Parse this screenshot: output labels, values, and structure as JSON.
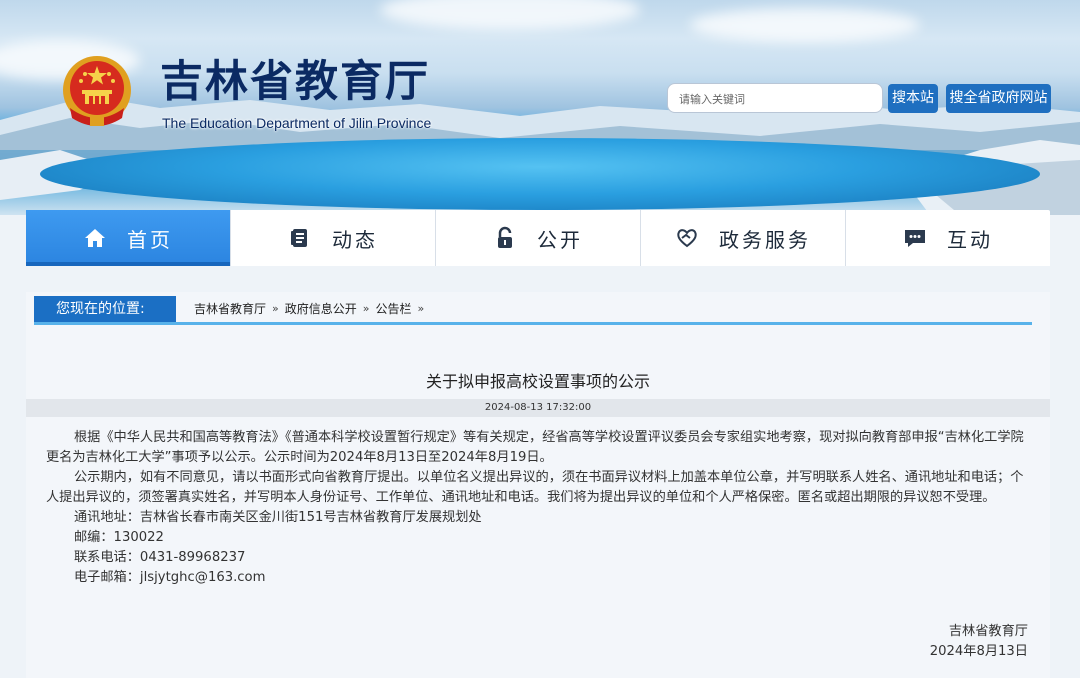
{
  "header": {
    "title": "吉林省教育厅",
    "subtitle": "The Education Department of Jilin Province",
    "search_placeholder": "请输入关键词",
    "search_site_label": "搜本站",
    "search_all_label": "搜全省政府网站"
  },
  "nav": {
    "items": [
      {
        "label": "首页",
        "icon": "home-icon",
        "active": true
      },
      {
        "label": "动态",
        "icon": "document-icon"
      },
      {
        "label": "公开",
        "icon": "lock-icon"
      },
      {
        "label": "政务服务",
        "icon": "heart-hands-icon"
      },
      {
        "label": "互动",
        "icon": "chat-icon"
      }
    ]
  },
  "breadcrumb": {
    "label": "您现在的位置:",
    "items": [
      "吉林省教育厅",
      "政府信息公开",
      "公告栏"
    ],
    "separator": "»"
  },
  "article": {
    "title": "关于拟申报高校设置事项的公示",
    "datetime": "2024-08-13 17:32:00",
    "paragraph1": "根据《中华人民共和国高等教育法》《普通本科学校设置暂行规定》等有关规定，经省高等学校设置评议委员会专家组实地考察，现对拟向教育部申报“吉林化工学院更名为吉林化工大学”事项予以公示。公示时间为2024年8月13日至2024年8月19日。",
    "paragraph2": "公示期内，如有不同意见，请以书面形式向省教育厅提出。以单位名义提出异议的，须在书面异议材料上加盖本单位公章，并写明联系人姓名、通讯地址和电话；个人提出异议的，须签署真实姓名，并写明本人身份证号、工作单位、通讯地址和电话。我们将为提出异议的单位和个人严格保密。匿名或超出期限的异议恕不受理。",
    "address": "通讯地址：吉林省长春市南关区金川街151号吉林省教育厅发展规划处",
    "postcode": "邮编：130022",
    "phone": "联系电话：0431-89968237",
    "email": "电子邮箱：jlsjytghc@163.com",
    "signer": "吉林省教育厅",
    "sign_date": "2024年8月13日"
  },
  "colors": {
    "brand_blue": "#1b6fc4",
    "nav_active": "#2b84e0",
    "title_navy": "#0b2a63"
  }
}
